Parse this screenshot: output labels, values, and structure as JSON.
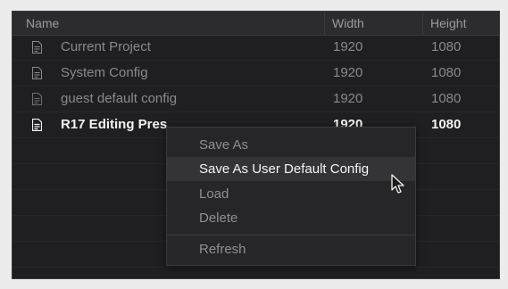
{
  "table": {
    "headers": {
      "name": "Name",
      "width": "Width",
      "height": "Height"
    },
    "rows": [
      {
        "name": "Current Project",
        "width": "1920",
        "height": "1080",
        "icon": "document-icon"
      },
      {
        "name": "System Config",
        "width": "1920",
        "height": "1080",
        "icon": "document-icon"
      },
      {
        "name": "guest default config",
        "width": "1920",
        "height": "1080",
        "icon": "document-icon"
      },
      {
        "name": "R17 Editing Pres",
        "width": "1920",
        "height": "1080",
        "icon": "document-icon"
      }
    ]
  },
  "context_menu": {
    "items": [
      {
        "label": "Save As"
      },
      {
        "label": "Save As User Default Config"
      },
      {
        "label": "Load"
      },
      {
        "label": "Delete"
      },
      {
        "label": "Refresh"
      }
    ]
  },
  "colors": {
    "panel_bg": "#1f1f21",
    "header_bg": "#2c2c2e",
    "menu_bg": "#262628",
    "menu_highlight": "#343437",
    "text_bright": "#f2f2f2",
    "text_dim": "#8a8a8e"
  }
}
